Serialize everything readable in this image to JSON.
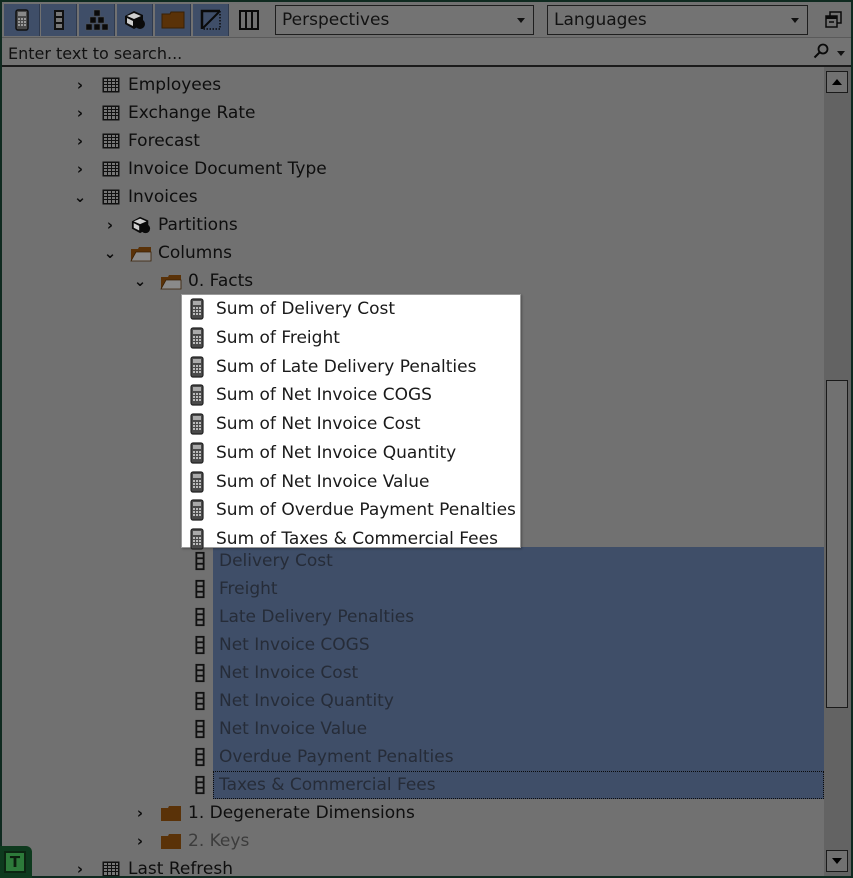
{
  "toolbar": {
    "buttons": [
      {
        "name": "measure",
        "icon": "calculator-icon",
        "active": true
      },
      {
        "name": "column",
        "icon": "column-icon",
        "active": true
      },
      {
        "name": "hierarchy",
        "icon": "hierarchy-icon",
        "active": true
      },
      {
        "name": "partition",
        "icon": "partition-icon",
        "active": true
      },
      {
        "name": "display-folder",
        "icon": "folder-icon",
        "active": true
      },
      {
        "name": "hidden-objects",
        "icon": "hidden-objects-icon",
        "active": true
      },
      {
        "name": "columns-view",
        "icon": "columns-view-icon",
        "active": false
      }
    ],
    "perspectives": {
      "selected": "Perspectives"
    },
    "languages": {
      "selected": "Languages"
    }
  },
  "search": {
    "placeholder": "Enter text to search...",
    "value": ""
  },
  "tree": {
    "items": [
      {
        "label": "Employees",
        "level": 0,
        "expanded": false,
        "icon": "table-icon"
      },
      {
        "label": "Exchange Rate",
        "level": 0,
        "expanded": false,
        "icon": "table-icon"
      },
      {
        "label": "Forecast",
        "level": 0,
        "expanded": false,
        "icon": "table-icon"
      },
      {
        "label": "Invoice Document Type",
        "level": 0,
        "expanded": false,
        "icon": "table-icon"
      },
      {
        "label": "Invoices",
        "level": 0,
        "expanded": true,
        "icon": "table-icon"
      },
      {
        "label": "Partitions",
        "level": 1,
        "expanded": false,
        "icon": "partition-icon"
      },
      {
        "label": "Columns",
        "level": 1,
        "expanded": true,
        "icon": "open-folder-icon"
      },
      {
        "label": "0. Facts",
        "level": 2,
        "expanded": true,
        "icon": "open-folder-icon"
      }
    ],
    "selected_columns": [
      "Delivery Cost",
      "Freight",
      "Late Delivery Penalties",
      "Net Invoice COGS",
      "Net Invoice Cost",
      "Net Invoice Quantity",
      "Net Invoice Value",
      "Overdue Payment Penalties",
      "Taxes & Commercial Fees"
    ],
    "after": [
      {
        "label": "1. Degenerate Dimensions",
        "level": 2,
        "expanded": false,
        "icon": "folder-icon",
        "dim": false
      },
      {
        "label": "2. Keys",
        "level": 2,
        "expanded": false,
        "icon": "folder-icon",
        "dim": true
      },
      {
        "label": "Last Refresh",
        "level": 0,
        "expanded": false,
        "icon": "table-icon",
        "dim": false
      }
    ]
  },
  "popup": {
    "items": [
      "Sum of Delivery Cost",
      "Sum of Freight",
      "Sum of Late Delivery Penalties",
      "Sum of Net Invoice COGS",
      "Sum of Net Invoice Cost",
      "Sum of Net Invoice Quantity",
      "Sum of Net Invoice Value",
      "Sum of Overdue Payment Penalties",
      "Sum of Taxes & Commercial Fees"
    ]
  },
  "badge": {
    "letter": "T"
  },
  "colors": {
    "background": "#717171",
    "toolbar_active": "#3f4e68",
    "selection": "#3f4e68",
    "folder": "#5a3208",
    "badge": "#2d7a3a"
  }
}
